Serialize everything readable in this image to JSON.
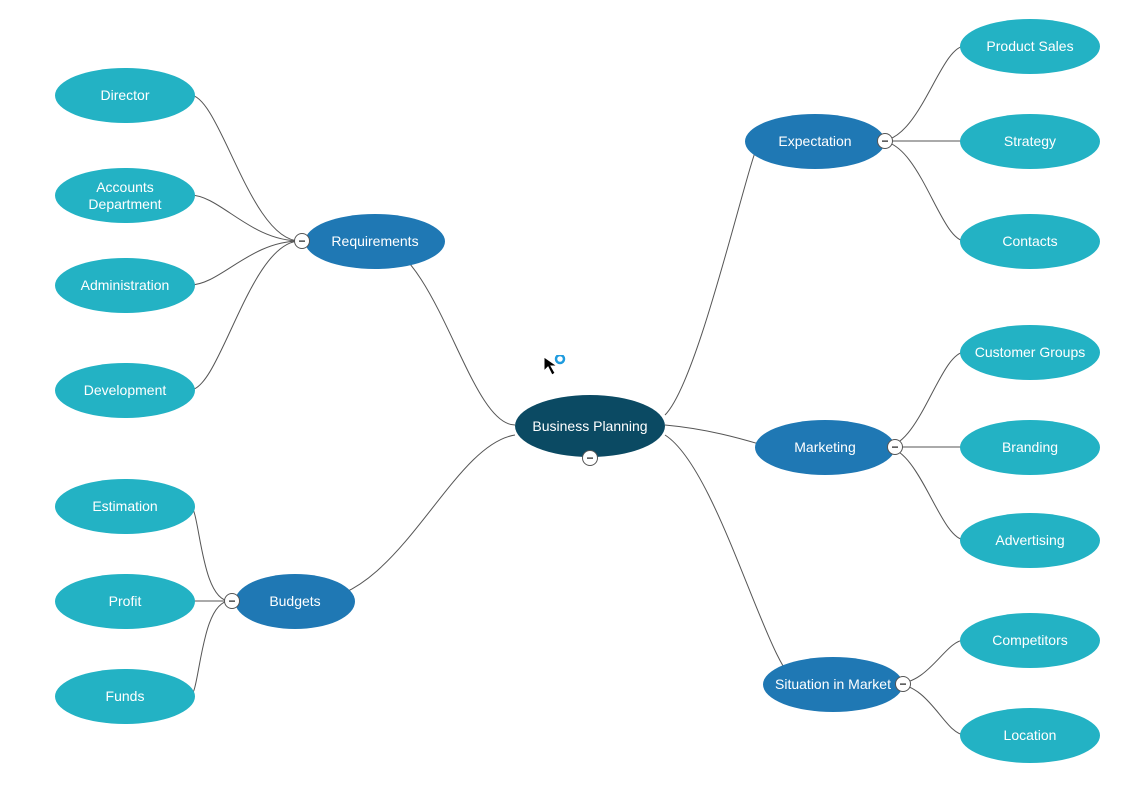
{
  "root": {
    "label": "Business Planning"
  },
  "branches": {
    "requirements": {
      "label": "Requirements",
      "children": [
        "Director",
        "Accounts Department",
        "Administration",
        "Development"
      ]
    },
    "budgets": {
      "label": "Budgets",
      "children": [
        "Estimation",
        "Profit",
        "Funds"
      ]
    },
    "expectation": {
      "label": "Expectation",
      "children": [
        "Product Sales",
        "Strategy",
        "Contacts"
      ]
    },
    "marketing": {
      "label": "Marketing",
      "children": [
        "Customer Groups",
        "Branding",
        "Advertising"
      ]
    },
    "situation": {
      "label": "Situation in Market",
      "children": [
        "Competitors",
        "Location"
      ]
    }
  },
  "toggle_glyph": "−",
  "colors": {
    "root": "#0b4a63",
    "branch": "#1f78b4",
    "leaf": "#23b2c4",
    "connector": "#555555"
  }
}
